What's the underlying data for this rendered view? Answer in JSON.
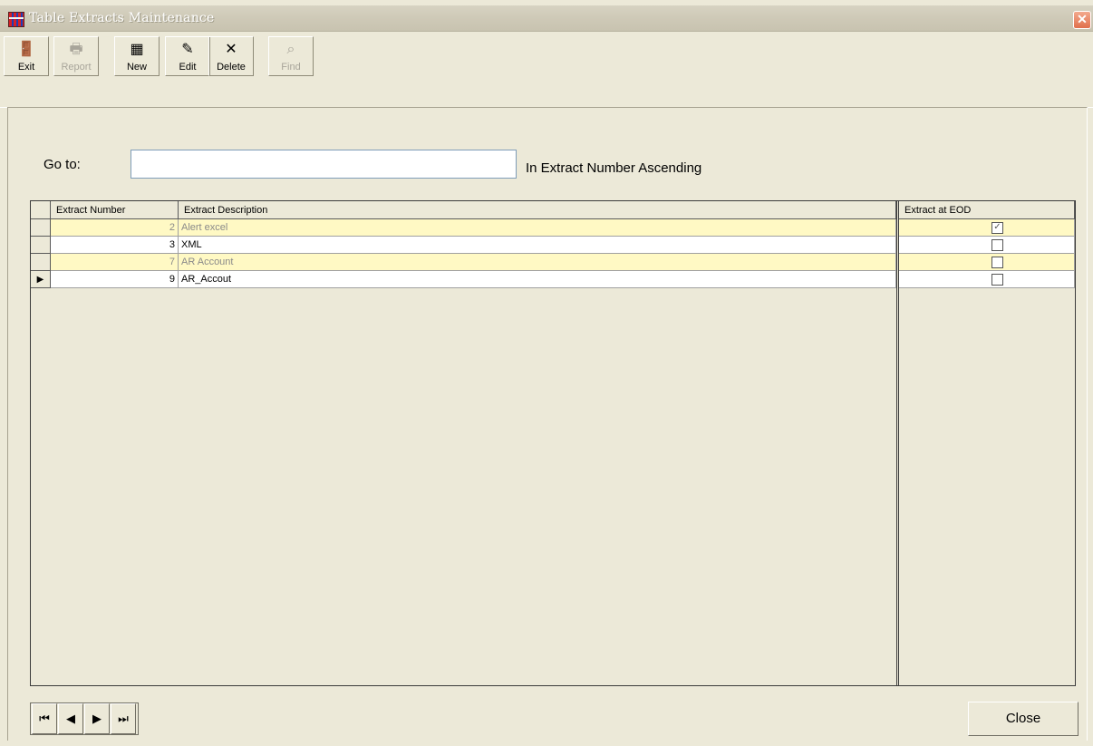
{
  "window": {
    "title": "Table Extracts Maintenance",
    "close_glyph": "✕"
  },
  "toolbar": [
    {
      "label": "Exit",
      "icon": "exit-door-icon",
      "glyph": "🚪",
      "enabled": true
    },
    {
      "label": "Report",
      "icon": "printer-icon",
      "glyph": "🖶",
      "enabled": false
    },
    {
      "label": "New",
      "icon": "new-record-icon",
      "glyph": "▦",
      "enabled": true
    },
    {
      "label": "Edit",
      "icon": "edit-record-icon",
      "glyph": "✎",
      "enabled": true
    },
    {
      "label": "Delete",
      "icon": "delete-x-icon",
      "glyph": "✕",
      "enabled": true
    },
    {
      "label": "Find",
      "icon": "binoculars-icon",
      "glyph": "⌕",
      "enabled": false
    }
  ],
  "goto": {
    "label": "Go to:",
    "value": "",
    "order_text": "In Extract Number Ascending"
  },
  "grid": {
    "columns": [
      "Extract Number",
      "Extract Description",
      "Extract at EOD"
    ],
    "rows": [
      {
        "number": "2",
        "description": "Alert excel",
        "eod": true,
        "highlight": true,
        "current": false
      },
      {
        "number": "3",
        "description": "XML",
        "eod": false,
        "highlight": false,
        "current": false
      },
      {
        "number": "7",
        "description": "AR Account",
        "eod": false,
        "highlight": true,
        "current": false
      },
      {
        "number": "9",
        "description": "AR_Accout",
        "eod": false,
        "highlight": false,
        "current": true
      }
    ]
  },
  "nav": {
    "first": "⏮",
    "prev": "◀",
    "next": "▶",
    "last": "⏭"
  },
  "buttons": {
    "close": "Close"
  },
  "colors": {
    "row_highlight": "#fff9c4",
    "row_normal": "#ffffff",
    "dim_text": "#8a8a8a"
  }
}
